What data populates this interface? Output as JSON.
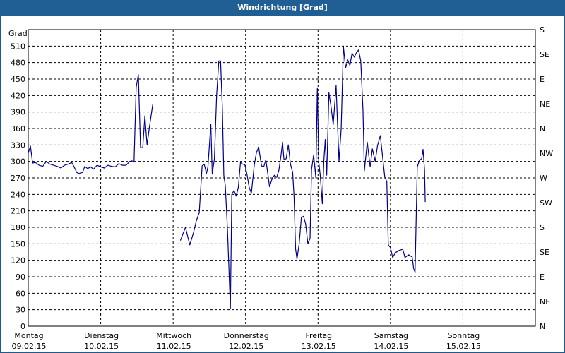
{
  "title": "Windrichtung [Grad]",
  "chart_data": {
    "type": "line",
    "title": "Windrichtung [Grad]",
    "ylabel": "Grad",
    "ylim": [
      0,
      540
    ],
    "yticks": [
      0,
      30,
      60,
      90,
      120,
      150,
      180,
      210,
      240,
      270,
      300,
      330,
      360,
      390,
      420,
      450,
      480,
      510
    ],
    "right_ticks": [
      {
        "value": 0,
        "label": "N"
      },
      {
        "value": 45,
        "label": "NE"
      },
      {
        "value": 90,
        "label": "E"
      },
      {
        "value": 135,
        "label": "SE"
      },
      {
        "value": 180,
        "label": "S"
      },
      {
        "value": 225,
        "label": "SW"
      },
      {
        "value": 270,
        "label": "W"
      },
      {
        "value": 315,
        "label": "NW"
      },
      {
        "value": 360,
        "label": "N"
      },
      {
        "value": 405,
        "label": "NE"
      },
      {
        "value": 450,
        "label": "E"
      },
      {
        "value": 495,
        "label": "SE"
      },
      {
        "value": 540,
        "label": "S"
      }
    ],
    "xlim": [
      0,
      7
    ],
    "x_categories": [
      {
        "day": "Montag",
        "date": "09.02.15"
      },
      {
        "day": "Dienstag",
        "date": "10.02.15"
      },
      {
        "day": "Mittwoch",
        "date": "11.02.15"
      },
      {
        "day": "Donnerstag",
        "date": "12.02.15"
      },
      {
        "day": "Freitag",
        "date": "13.02.15"
      },
      {
        "day": "Samstag",
        "date": "14.02.15"
      },
      {
        "day": "Sonntag",
        "date": "15.02.15"
      }
    ],
    "grid": true,
    "line_color": "#00008b",
    "series": [
      {
        "segments": [
          [
            [
              0.0,
              315
            ],
            [
              0.03,
              328
            ],
            [
              0.06,
              297
            ],
            [
              0.1,
              298
            ],
            [
              0.15,
              293
            ],
            [
              0.2,
              291
            ],
            [
              0.25,
              300
            ],
            [
              0.3,
              295
            ],
            [
              0.35,
              293
            ],
            [
              0.4,
              291
            ],
            [
              0.45,
              288
            ],
            [
              0.5,
              293
            ],
            [
              0.55,
              295
            ],
            [
              0.6,
              298
            ],
            [
              0.63,
              291
            ],
            [
              0.67,
              280
            ],
            [
              0.7,
              278
            ],
            [
              0.75,
              280
            ],
            [
              0.78,
              291
            ],
            [
              0.82,
              287
            ],
            [
              0.86,
              290
            ],
            [
              0.9,
              286
            ],
            [
              0.95,
              293
            ],
            [
              1.0,
              290
            ],
            [
              1.05,
              288
            ],
            [
              1.1,
              293
            ],
            [
              1.15,
              291
            ],
            [
              1.2,
              290
            ],
            [
              1.25,
              296
            ],
            [
              1.3,
              293
            ],
            [
              1.35,
              293
            ],
            [
              1.4,
              300
            ],
            [
              1.43,
              301
            ],
            [
              1.46,
              300
            ],
            [
              1.49,
              435
            ],
            [
              1.52,
              458
            ],
            [
              1.55,
              325
            ],
            [
              1.58,
              325
            ],
            [
              1.61,
              383
            ],
            [
              1.64,
              330
            ],
            [
              1.67,
              360
            ],
            [
              1.72,
              405
            ]
          ],
          [
            [
              2.1,
              156
            ],
            [
              2.17,
              180
            ],
            [
              2.23,
              148
            ],
            [
              2.28,
              170
            ],
            [
              2.32,
              192
            ],
            [
              2.36,
              207
            ],
            [
              2.4,
              292
            ],
            [
              2.43,
              295
            ],
            [
              2.46,
              278
            ],
            [
              2.48,
              290
            ],
            [
              2.52,
              368
            ],
            [
              2.54,
              277
            ],
            [
              2.57,
              305
            ],
            [
              2.6,
              420
            ],
            [
              2.63,
              483
            ],
            [
              2.655,
              483
            ],
            [
              2.68,
              395
            ],
            [
              2.7,
              275
            ],
            [
              2.72,
              256
            ],
            [
              2.75,
              175
            ],
            [
              2.77,
              106
            ],
            [
              2.79,
              32
            ],
            [
              2.81,
              240
            ],
            [
              2.84,
              247
            ],
            [
              2.87,
              237
            ],
            [
              2.9,
              253
            ],
            [
              2.93,
              298
            ],
            [
              2.96,
              295
            ],
            [
              2.99,
              294
            ],
            [
              3.02,
              276
            ],
            [
              3.05,
              253
            ],
            [
              3.08,
              242
            ],
            [
              3.12,
              293
            ],
            [
              3.15,
              316
            ],
            [
              3.18,
              326
            ],
            [
              3.22,
              292
            ],
            [
              3.25,
              290
            ],
            [
              3.28,
              303
            ],
            [
              3.31,
              275
            ],
            [
              3.33,
              254
            ],
            [
              3.37,
              270
            ],
            [
              3.4,
              275
            ],
            [
              3.43,
              271
            ],
            [
              3.46,
              284
            ],
            [
              3.49,
              312
            ],
            [
              3.51,
              335
            ],
            [
              3.53,
              303
            ],
            [
              3.56,
              305
            ],
            [
              3.59,
              330
            ],
            [
              3.62,
              295
            ],
            [
              3.65,
              280
            ],
            [
              3.67,
              235
            ],
            [
              3.69,
              141
            ],
            [
              3.71,
              122
            ],
            [
              3.74,
              150
            ],
            [
              3.77,
              198
            ],
            [
              3.8,
              200
            ],
            [
              3.83,
              186
            ],
            [
              3.86,
              150
            ],
            [
              3.89,
              160
            ],
            [
              3.91,
              285
            ],
            [
              3.94,
              312
            ],
            [
              3.97,
              270
            ],
            [
              3.99,
              434
            ],
            [
              4.01,
              299
            ],
            [
              4.03,
              275
            ],
            [
              4.06,
              223
            ],
            [
              4.08,
              300
            ],
            [
              4.1,
              340
            ],
            [
              4.12,
              275
            ],
            [
              4.15,
              425
            ],
            [
              4.18,
              400
            ],
            [
              4.21,
              367
            ],
            [
              4.25,
              438
            ],
            [
              4.27,
              365
            ],
            [
              4.29,
              300
            ],
            [
              4.32,
              360
            ],
            [
              4.35,
              510
            ],
            [
              4.38,
              470
            ],
            [
              4.41,
              485
            ],
            [
              4.44,
              475
            ],
            [
              4.47,
              497
            ],
            [
              4.5,
              490
            ],
            [
              4.53,
              498
            ],
            [
              4.56,
              503
            ],
            [
              4.59,
              483
            ],
            [
              4.62,
              395
            ],
            [
              4.64,
              283
            ],
            [
              4.68,
              335
            ],
            [
              4.72,
              290
            ],
            [
              4.75,
              323
            ],
            [
              4.79,
              300
            ],
            [
              4.82,
              328
            ],
            [
              4.86,
              347
            ],
            [
              4.88,
              323
            ],
            [
              4.92,
              273
            ],
            [
              4.95,
              263
            ],
            [
              4.97,
              148
            ],
            [
              5.0,
              143
            ],
            [
              5.03,
              125
            ],
            [
              5.07,
              134
            ],
            [
              5.12,
              138
            ],
            [
              5.17,
              140
            ],
            [
              5.2,
              125
            ],
            [
              5.25,
              130
            ],
            [
              5.3,
              126
            ],
            [
              5.32,
              105
            ],
            [
              5.34,
              98
            ],
            [
              5.37,
              290
            ],
            [
              5.4,
              302
            ],
            [
              5.43,
              305
            ],
            [
              5.45,
              322
            ],
            [
              5.47,
              285
            ],
            [
              5.48,
              226
            ]
          ]
        ]
      }
    ]
  }
}
